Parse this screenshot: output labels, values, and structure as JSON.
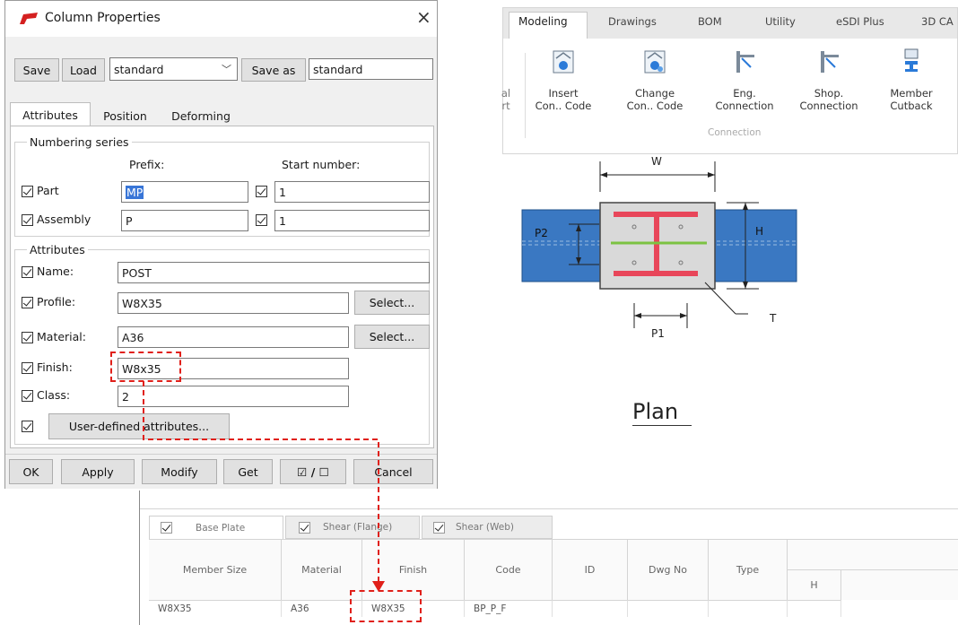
{
  "dialog": {
    "title": "Column Properties",
    "close_glyph": "×",
    "toolbar": {
      "save_label": "Save",
      "load_label": "Load",
      "preset_value": "standard",
      "save_as_label": "Save as",
      "save_as_value": "standard"
    },
    "tabs": [
      "Attributes",
      "Position",
      "Deforming"
    ],
    "numbering": {
      "group_label": "Numbering series",
      "prefix_header": "Prefix:",
      "start_header": "Start number:",
      "rows": [
        {
          "label": "Part",
          "prefix": "MP",
          "start": "1"
        },
        {
          "label": "Assembly",
          "prefix": "P",
          "start": "1"
        }
      ]
    },
    "attributes": {
      "group_label": "Attributes",
      "name_label": "Name:",
      "name_value": "POST",
      "profile_label": "Profile:",
      "profile_value": "W8X35",
      "profile_select": "Select...",
      "material_label": "Material:",
      "material_value": "A36",
      "material_select": "Select...",
      "finish_label": "Finish:",
      "finish_value": "W8x35",
      "class_label": "Class:",
      "class_value": "2",
      "uda_label": "User-defined attributes..."
    },
    "footer": {
      "ok": "OK",
      "apply": "Apply",
      "modify": "Modify",
      "get": "Get",
      "toggle": "☑ / ☐",
      "cancel": "Cancel"
    }
  },
  "ribbon": {
    "tabs": [
      "Modeling",
      "Drawings",
      "BOM",
      "Utility",
      "eSDI Plus",
      "3D CA"
    ],
    "active_tab": "Modeling",
    "partial_left": [
      "al",
      "rt"
    ],
    "buttons": [
      {
        "line1": "Insert",
        "line2": "Con.. Code"
      },
      {
        "line1": "Change",
        "line2": "Con.. Code"
      },
      {
        "line1": "Eng.",
        "line2": "Connection"
      },
      {
        "line1": "Shop.",
        "line2": "Connection"
      },
      {
        "line1": "Member",
        "line2": "Cutback"
      }
    ],
    "group_label": "Connection"
  },
  "plan": {
    "label_w": "W",
    "label_h": "H",
    "label_p1": "P1",
    "label_p2": "P2",
    "label_t": "T",
    "title": "Plan"
  },
  "table": {
    "tabs": [
      "Base Plate",
      "Shear (Flange)",
      "Shear (Web)"
    ],
    "headers": [
      "Member Size",
      "Material",
      "Finish",
      "Code",
      "ID",
      "Dwg No",
      "Type",
      "H"
    ],
    "row": [
      "W8X35",
      "A36",
      "W8X35",
      "BP_P_F",
      "",
      "",
      "",
      ""
    ]
  },
  "colors": {
    "accent_red": "#e0201a",
    "beam_blue": "#3a78c2",
    "plate_gray": "#d9d9d9",
    "flange_red": "#e8465a",
    "web_green": "#7cc242"
  }
}
